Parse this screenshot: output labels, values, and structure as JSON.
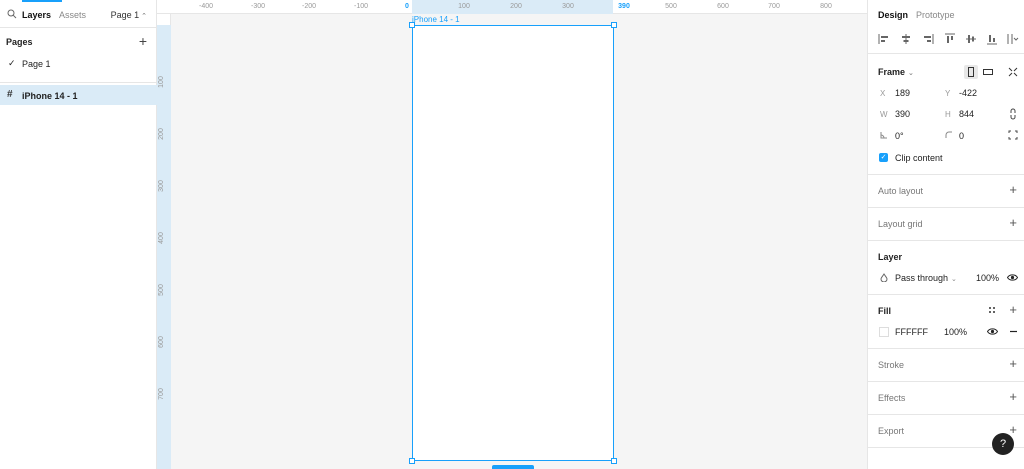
{
  "left_panel": {
    "tabs": {
      "layers": "Layers",
      "assets": "Assets"
    },
    "page_selector": "Page 1",
    "pages": {
      "title": "Pages",
      "add": "+",
      "items": [
        {
          "label": "Page 1",
          "check": "✓"
        }
      ]
    },
    "layers": [
      {
        "label": "iPhone 14 - 1",
        "icon": "#"
      }
    ]
  },
  "rulers": {
    "top": [
      "-400",
      "-300",
      "-200",
      "-100",
      "0",
      "100",
      "200",
      "300",
      "390",
      "500",
      "600",
      "700",
      "800"
    ],
    "left": [
      "100",
      "200",
      "300",
      "400",
      "500",
      "600",
      "700"
    ]
  },
  "canvas": {
    "frame_label": "iPhone 14 - 1"
  },
  "right_panel": {
    "tabs": {
      "design": "Design",
      "prototype": "Prototype"
    },
    "frame": {
      "title": "Frame",
      "x_label": "X",
      "x": "189",
      "y_label": "Y",
      "y": "-422",
      "w_label": "W",
      "w": "390",
      "h_label": "H",
      "h": "844",
      "rotation": "0°",
      "radius": "0",
      "clip_label": "Clip content"
    },
    "auto_layout": "Auto layout",
    "layout_grid": "Layout grid",
    "layer": {
      "title": "Layer",
      "blend": "Pass through",
      "opacity": "100%"
    },
    "fill": {
      "title": "Fill",
      "hex": "FFFFFF",
      "opacity": "100%"
    },
    "stroke": "Stroke",
    "effects": "Effects",
    "export": "Export"
  },
  "help": "?",
  "colors": {
    "accent": "#18a0fb",
    "selection_bg": "#daebf7",
    "canvas": "#f5f5f5"
  }
}
